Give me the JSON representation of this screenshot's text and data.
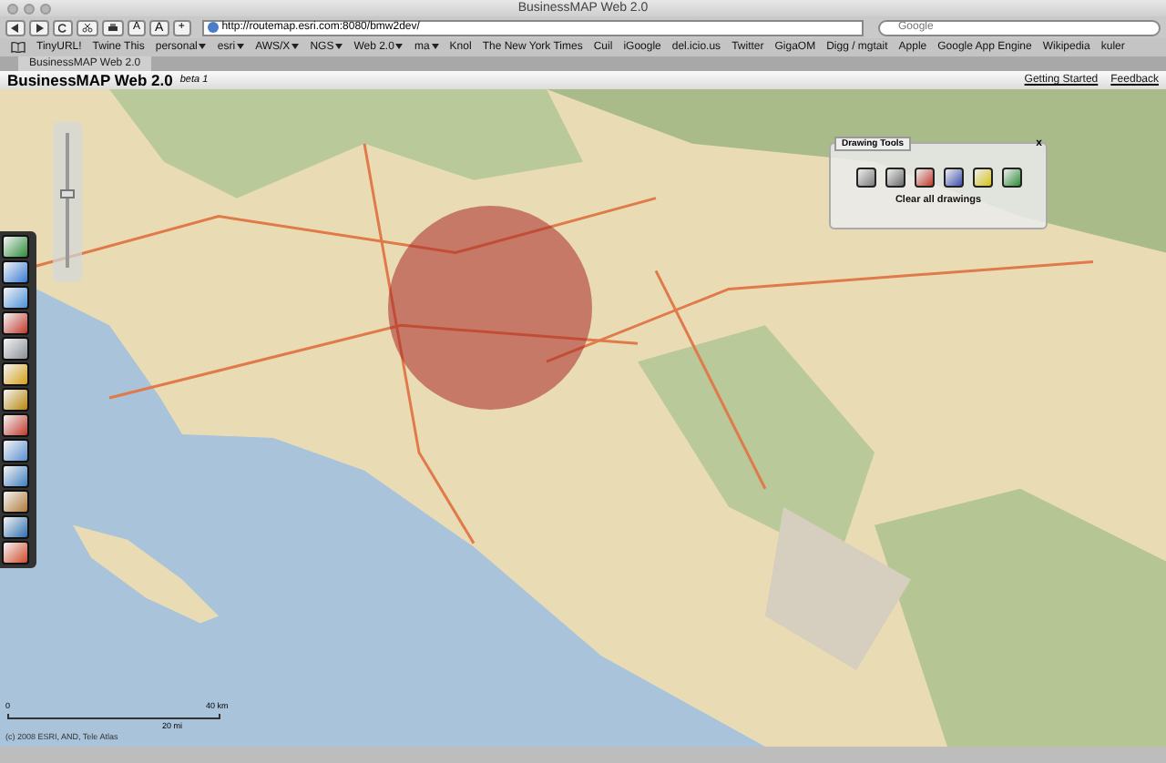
{
  "window": {
    "title": "BusinessMAP Web 2.0"
  },
  "toolbar": {
    "url": "http://routemap.esri.com:8080/bmw2dev/",
    "search_placeholder": "Google",
    "font_buttons": [
      "A",
      "A"
    ],
    "add_button": "+"
  },
  "bookmarks": [
    {
      "label": "TinyURL!",
      "menu": false
    },
    {
      "label": "Twine This",
      "menu": false
    },
    {
      "label": "personal",
      "menu": true
    },
    {
      "label": "esri",
      "menu": true
    },
    {
      "label": "AWS/X",
      "menu": true
    },
    {
      "label": "NGS",
      "menu": true
    },
    {
      "label": "Web 2.0",
      "menu": true
    },
    {
      "label": "ma",
      "menu": true
    },
    {
      "label": "Knol",
      "menu": false
    },
    {
      "label": "The New York Times",
      "menu": false
    },
    {
      "label": "Cuil",
      "menu": false
    },
    {
      "label": "iGoogle",
      "menu": false
    },
    {
      "label": "del.icio.us",
      "menu": false
    },
    {
      "label": "Twitter",
      "menu": false
    },
    {
      "label": "GigaOM",
      "menu": false
    },
    {
      "label": "Digg / mgtait",
      "menu": false
    },
    {
      "label": "Apple",
      "menu": false
    },
    {
      "label": "Google App Engine",
      "menu": false
    },
    {
      "label": "Wikipedia",
      "menu": false
    },
    {
      "label": "kuler",
      "menu": false
    }
  ],
  "tabs": [
    {
      "label": "BusinessMAP Web 2.0",
      "selected": true
    }
  ],
  "app": {
    "title": "BusinessMAP Web 2.0",
    "badge": "beta 1",
    "links": [
      "Getting Started",
      "Feedback"
    ]
  },
  "zoom_slider": {
    "level": 0.55
  },
  "drawing_tools": {
    "title": "Drawing Tools",
    "close": "x",
    "clear": "Clear all drawings"
  },
  "scale_bar": {
    "zero": "0",
    "km": "40 km",
    "mi": "20 mi"
  },
  "copyright": "(c) 2008 ESRI, AND, Tele Atlas"
}
